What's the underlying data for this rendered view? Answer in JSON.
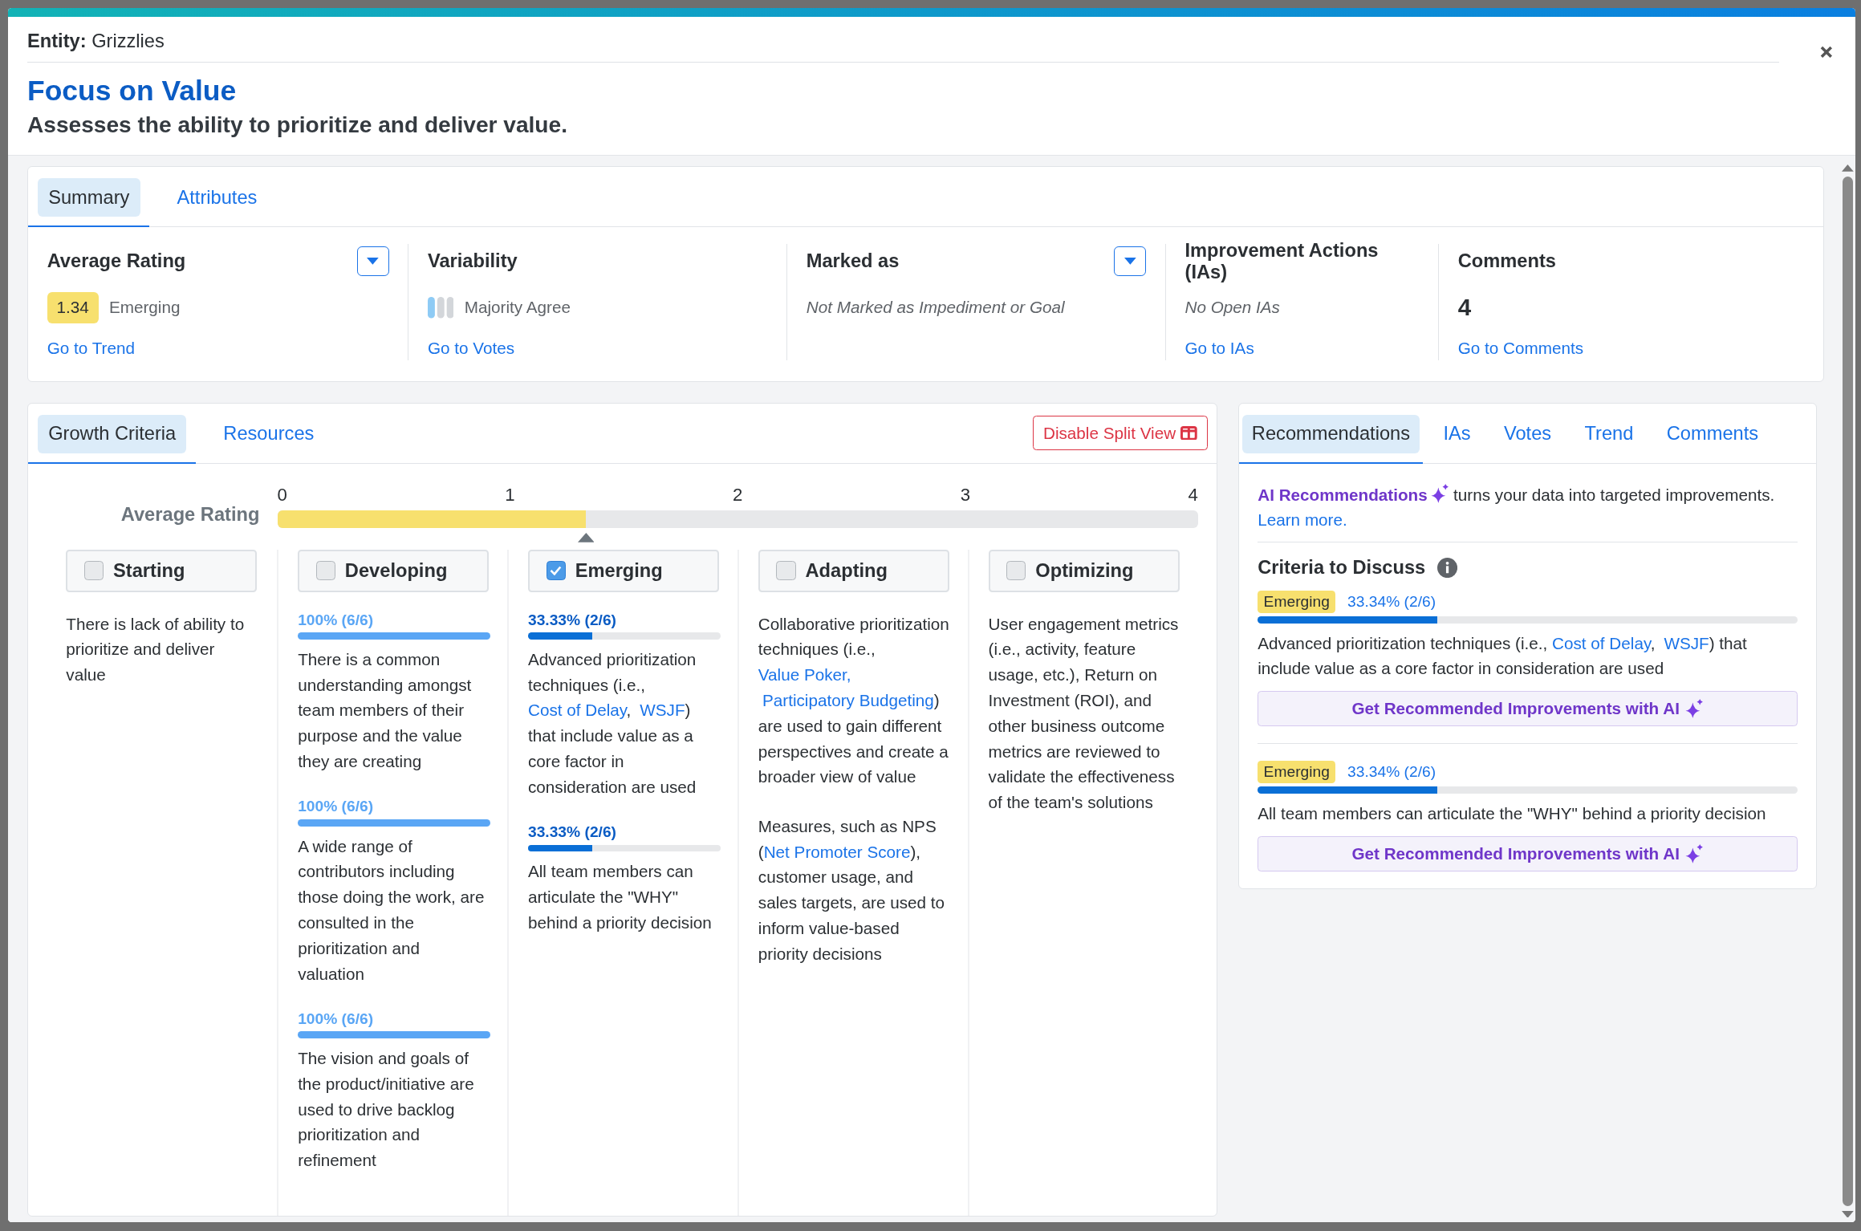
{
  "header": {
    "entity": "**Entity:** Grizzlies",
    "title": "Focus on Value",
    "subtitle": "Assesses the ability to prioritize and deliver value."
  },
  "summary": {
    "tabs": [
      {
        "label": "Summary",
        "selected": true
      },
      {
        "label": "Attributes",
        "selected": false
      }
    ],
    "cells": [
      {
        "kind": "rating",
        "title": "Average Rating",
        "dropdown": true,
        "badge": "1.34",
        "value": "Emerging",
        "link": "Go to Trend"
      },
      {
        "kind": "variability",
        "title": "Variability",
        "dropdown": false,
        "value": "Majority Agree",
        "link": "Go to Votes"
      },
      {
        "kind": "note",
        "title": "Marked as",
        "dropdown": true,
        "value": "Not Marked as Impediment or Goal"
      },
      {
        "kind": "note",
        "title": "Improvement Actions (IAs)",
        "dropdown": false,
        "value": "No Open IAs",
        "link": "Go to IAs"
      },
      {
        "kind": "count",
        "title": "Comments",
        "dropdown": false,
        "value": "4",
        "link": "Go to Comments"
      }
    ]
  },
  "growth": {
    "tabs": [
      {
        "label": "Growth Criteria",
        "selected": true
      },
      {
        "label": "Resources",
        "selected": false
      }
    ],
    "split_button": "Disable Split View",
    "scale": {
      "label": "Average Rating",
      "ticks": [
        "0",
        "1",
        "2",
        "3",
        "4"
      ],
      "level": 0.335
    },
    "columns": [
      {
        "name": "Starting",
        "checked": false,
        "items": [
          {
            "text": [
              {
                "t": "There is lack of ability to prioritize and deliver value"
              }
            ]
          }
        ]
      },
      {
        "name": "Developing",
        "checked": false,
        "items": [
          {
            "percent": "100% (6/6)",
            "level": 1,
            "text": [
              {
                "t": "There is a common understanding amongst team members of their purpose and the value they are creating"
              }
            ]
          },
          {
            "percent": "100% (6/6)",
            "level": 1,
            "text": [
              {
                "t": "A wide range of contributors including those doing the work, are consulted in the prioritization and valuation"
              }
            ]
          },
          {
            "percent": "100% (6/6)",
            "level": 1,
            "text": [
              {
                "t": "The vision and goals of the product/initiative are used to drive backlog prioritization and refinement"
              }
            ]
          }
        ]
      },
      {
        "name": "Emerging",
        "checked": true,
        "items": [
          {
            "percent": "33.33% (2/6)",
            "level": 0.3333,
            "text": [
              {
                "t": "Advanced prioritization techniques (i.e., "
              },
              {
                "t": "Cost of Delay",
                "link": true
              },
              {
                "t": ", "
              },
              {
                "t": "WSJF",
                "link": true
              },
              {
                "t": ") that include value as a core factor in consideration are used"
              }
            ]
          },
          {
            "percent": "33.33% (2/6)",
            "level": 0.3333,
            "text": [
              {
                "t": "All team members can articulate the \"WHY\" behind a priority decision"
              }
            ]
          }
        ]
      },
      {
        "name": "Adapting",
        "checked": false,
        "items": [
          {
            "text": [
              {
                "t": "Collaborative prioritization techniques (i.e., "
              },
              {
                "t": "Value Poker,",
                "link": true
              },
              {
                "t": "Participatory Budgeting",
                "link": true
              },
              {
                "t": ") are used to gain different perspectives and create a broader view of value"
              }
            ]
          },
          {
            "text": [
              {
                "t": "Measures, such as NPS ("
              },
              {
                "t": "Net Promoter Score",
                "link": true
              },
              {
                "t": "), customer usage, and sales targets, are used to inform value-based priority decisions"
              }
            ]
          }
        ]
      },
      {
        "name": "Optimizing",
        "checked": false,
        "items": [
          {
            "text": [
              {
                "t": "User engagement metrics (i.e., activity, feature usage, etc.), Return on Investment (ROI), and other business outcome metrics are reviewed to validate the effectiveness of the team's solutions"
              }
            ]
          }
        ]
      }
    ]
  },
  "recommendations": {
    "tabs": [
      {
        "label": "Recommendations",
        "selected": true
      },
      {
        "label": "IAs",
        "selected": false
      },
      {
        "label": "Votes",
        "selected": false
      },
      {
        "label": "Trend",
        "selected": false
      },
      {
        "label": "Comments",
        "selected": false
      }
    ],
    "intro_brand": "AI Recommendations",
    "intro_text": " turns your data into targeted improvements.",
    "learn_more": "Learn more.",
    "section_title": "Criteria to Discuss",
    "criteria": [
      {
        "badge": "Emerging",
        "percent": "33.34% (2/6)",
        "level": 0.3334,
        "text": [
          {
            "t": "Advanced prioritization techniques (i.e., "
          },
          {
            "t": "Cost of Delay",
            "link": true
          },
          {
            "t": ", "
          },
          {
            "t": "WSJF",
            "link": true
          },
          {
            "t": ") that include value as a core factor in consideration are used"
          }
        ],
        "button": "Get Recommended Improvements with AI"
      },
      {
        "badge": "Emerging",
        "percent": "33.34% (2/6)",
        "level": 0.3334,
        "text": [
          {
            "t": "All team members can articulate the \"WHY\" behind a priority decision"
          }
        ],
        "button": "Get Recommended Improvements with AI"
      }
    ]
  }
}
